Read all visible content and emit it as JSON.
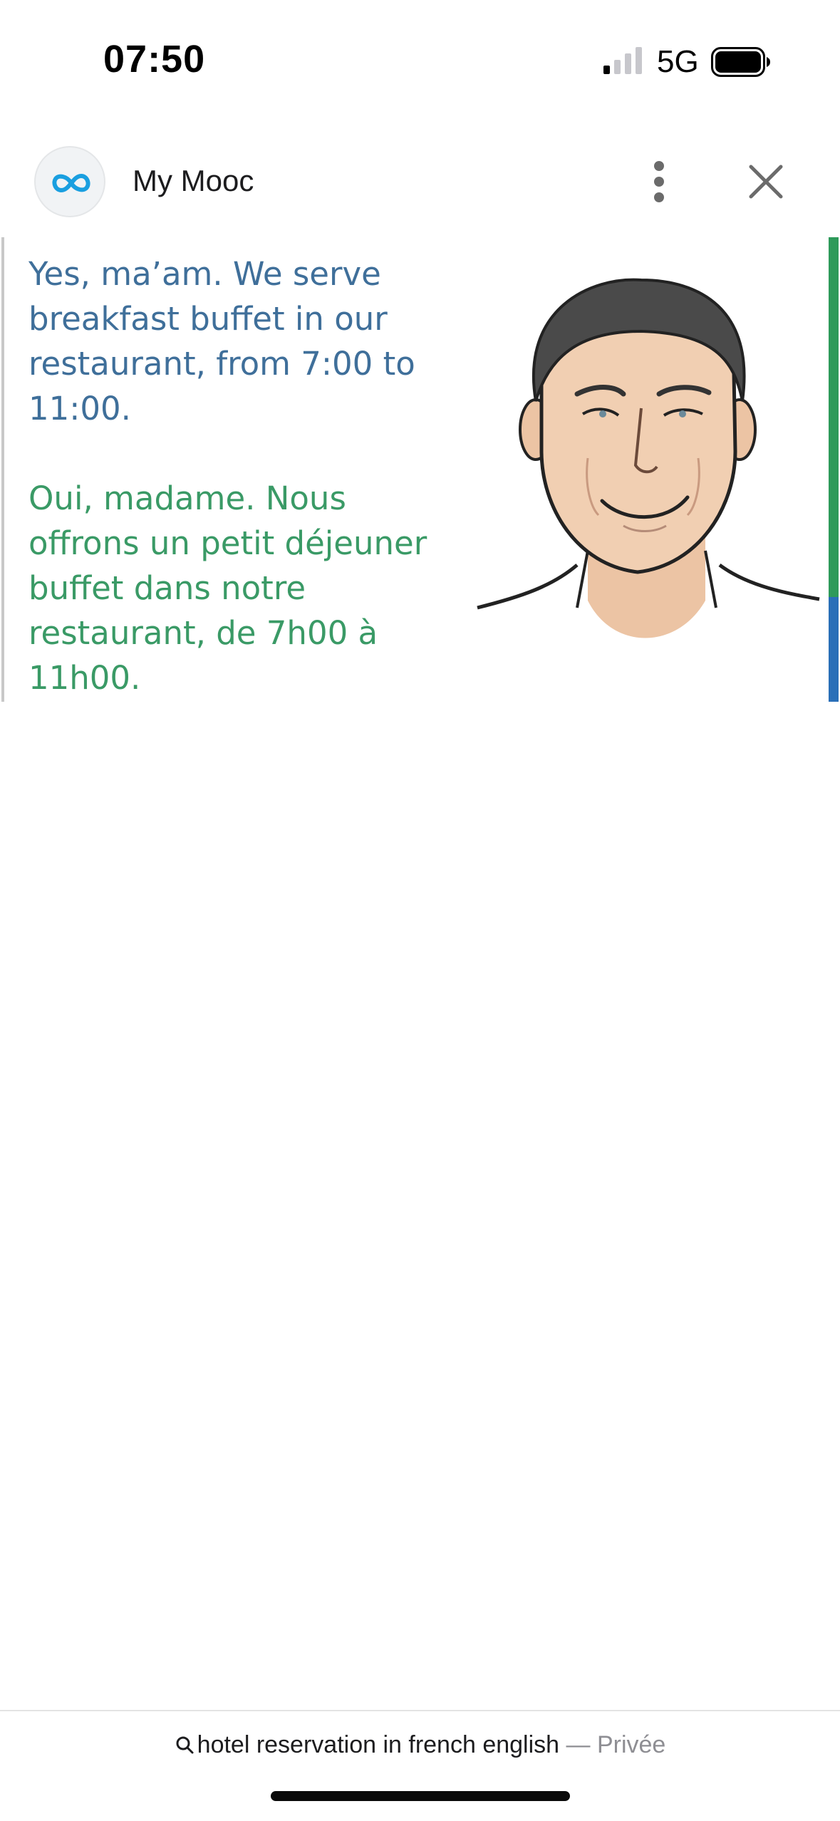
{
  "status_bar": {
    "time": "07:50",
    "network": "5G",
    "signal_icon": "signal-bars-icon",
    "battery_icon": "battery-full-icon"
  },
  "header": {
    "logo_icon": "infinity-logo-icon",
    "title": "My Mooc",
    "more_icon": "more-vertical-icon",
    "close_icon": "close-icon"
  },
  "hero": {
    "english_text": "Yes, ma’am. We serve\nbreakfast buffet in our\nrestaurant, from 7:00 to\n11:00.",
    "french_text": "Oui, madame. Nous\noffrons un petit déjeuner\nbuffet dans notre\nrestaurant, de 7h00 à\n11h00.",
    "image_subject": "cartoon-man-portrait",
    "english_color": "#3f6f9a",
    "french_color": "#3a9a66",
    "accent_green": "#2e9a5a",
    "accent_blue": "#2a6fb8"
  },
  "url_bar": {
    "search_icon": "search-icon",
    "query": "hotel reservation in french english",
    "mode": " — Privée"
  }
}
